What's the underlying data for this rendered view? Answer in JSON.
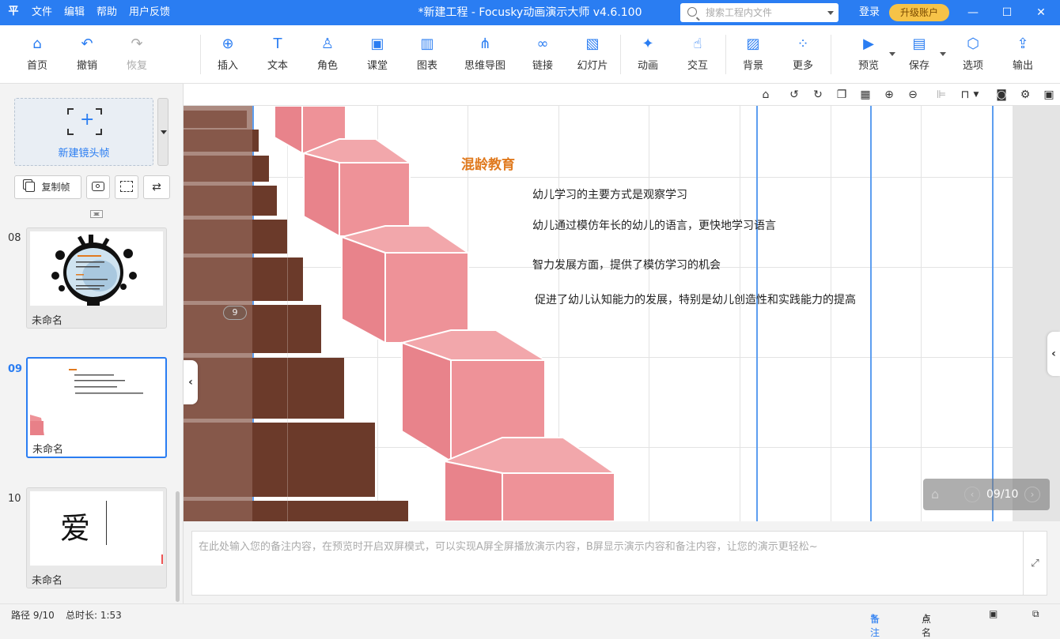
{
  "titlebar": {
    "logo": "平",
    "menu": [
      "文件",
      "编辑",
      "帮助",
      "用户反馈"
    ],
    "title": "*新建工程 - Focusky动画演示大师  v4.6.100",
    "search_placeholder": "搜索工程内文件",
    "login": "登录",
    "upgrade": "升级账户",
    "controls": [
      "—",
      "☐",
      "✕"
    ]
  },
  "toolbar": {
    "home": "首页",
    "undo": "撤销",
    "redo": "恢复",
    "insert": "插入",
    "text": "文本",
    "role": "角色",
    "classroom": "课堂",
    "chart": "图表",
    "mindmap": "思维导图",
    "link": "链接",
    "slide": "幻灯片",
    "animation": "动画",
    "interact": "交互",
    "background": "背景",
    "more": "更多",
    "preview": "预览",
    "save": "保存",
    "options": "选项",
    "export": "输出"
  },
  "left": {
    "new_frame": "新建镜头帧",
    "copy_frame": "复制帧",
    "frames": [
      {
        "num": "08",
        "name": "未命名"
      },
      {
        "num": "09",
        "name": "未命名"
      },
      {
        "num": "10",
        "name": "未命名",
        "glyph": "爱"
      }
    ]
  },
  "slide": {
    "badge": "9",
    "heading": "混龄教育",
    "lines": [
      "幼儿学习的主要方式是观察学习",
      "幼儿通过模仿年长的幼儿的语言，更快地学习语言",
      "智力发展方面，提供了模仿学习的机会",
      "促进了幼儿认知能力的发展，特别是幼儿创造性和实践能力的提高"
    ]
  },
  "nav": {
    "page": "09/10"
  },
  "notes": {
    "placeholder": "在此处输入您的备注内容，在预览时开启双屏模式，可以实现A屏全屏播放演示内容，B屏显示演示内容和备注内容，让您的演示更轻松~"
  },
  "status": {
    "path": "路径 9/10",
    "duration": "总时长: 1:53",
    "notes": "备注",
    "rollcall": "点名"
  },
  "colors": {
    "accent": "#2a7df2",
    "heading": "#e07a1f",
    "stair": "#6b3a2a",
    "cube": "#ee9298",
    "upgrade": "#f6c348"
  }
}
